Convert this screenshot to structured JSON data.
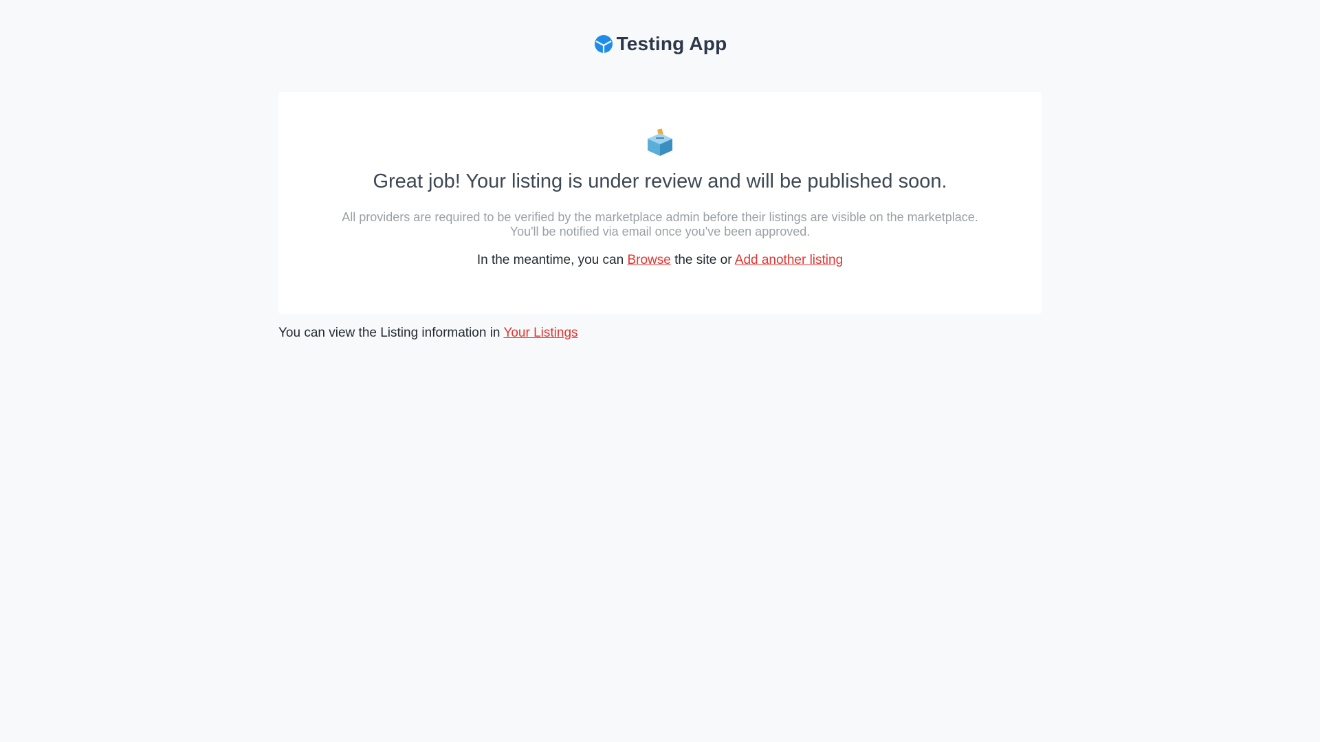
{
  "header": {
    "app_name": "Testing App"
  },
  "card": {
    "headline": "Great job! Your listing is under review and will be published soon.",
    "description_line1": "All providers are required to be verified by the marketplace admin before their listings are visible on the marketplace.",
    "description_line2": "You'll be notified via email once you've been approved.",
    "meantime_prefix": "In the meantime, you can ",
    "browse_link": "Browse",
    "meantime_middle": " the site or ",
    "add_listing_link": "Add another listing"
  },
  "footer": {
    "prefix": "You can view the Listing information in ",
    "your_listings_link": "Your Listings"
  },
  "colors": {
    "background": "#f7f9fa",
    "link": "#e3342f",
    "logo_blue": "#1f8ceb"
  },
  "icons": {
    "logo": "logo-icon",
    "ballot_box": "ballot-box-icon"
  }
}
